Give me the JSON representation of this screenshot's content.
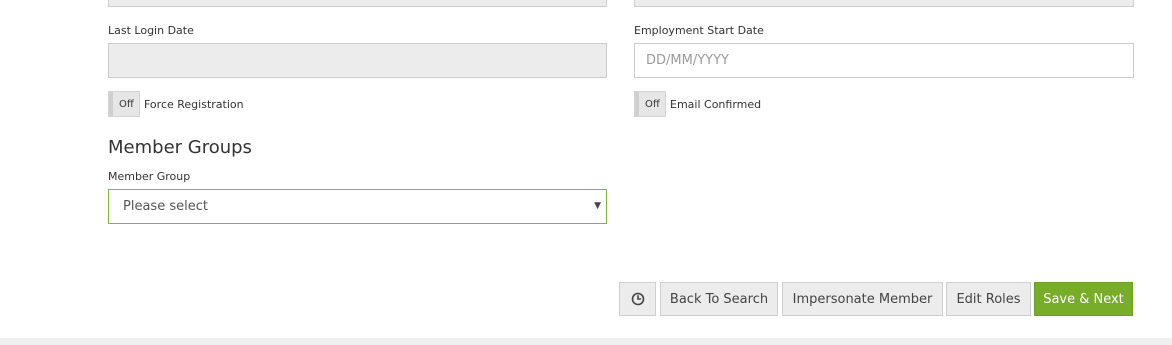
{
  "form": {
    "last_login": {
      "label": "Last Login Date",
      "value": ""
    },
    "employment_start": {
      "label": "Employment Start Date",
      "value": "",
      "placeholder": "DD/MM/YYYY"
    },
    "force_registration": {
      "state": "Off",
      "label": "Force Registration"
    },
    "email_confirmed": {
      "state": "Off",
      "label": "Email Confirmed"
    }
  },
  "member_groups": {
    "title": "Member Groups",
    "field_label": "Member Group",
    "selected": "Please select"
  },
  "actions": {
    "history_icon": "clock-icon",
    "back_to_search": "Back To Search",
    "impersonate": "Impersonate Member",
    "edit_roles": "Edit Roles",
    "save_next": "Save & Next"
  },
  "colors": {
    "accent": "#77ad28",
    "select_border": "#7cb83b"
  }
}
